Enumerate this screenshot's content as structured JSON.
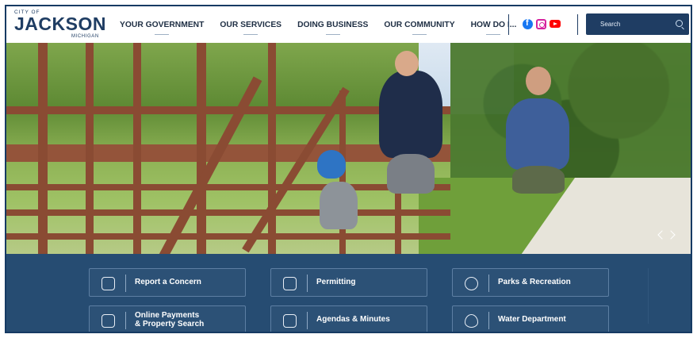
{
  "logo": {
    "top": "CITY OF",
    "main": "JACKSON",
    "sub": "MICHIGAN"
  },
  "nav": {
    "items": [
      {
        "label": "YOUR GOVERNMENT"
      },
      {
        "label": "OUR SERVICES"
      },
      {
        "label": "DOING BUSINESS"
      },
      {
        "label": "OUR COMMUNITY"
      },
      {
        "label": "HOW DO I..."
      }
    ]
  },
  "social": {
    "icons": [
      "facebook-icon",
      "instagram-icon",
      "youtube-icon"
    ]
  },
  "search": {
    "placeholder": "Search"
  },
  "hero": {
    "alt_colors": {
      "bridge": "#8a4b33",
      "foliage": "#4c7a30"
    }
  },
  "quick_links": [
    {
      "label": "Report a Concern",
      "icon": "chat-icon"
    },
    {
      "label": "Permitting",
      "icon": "clipboard-icon"
    },
    {
      "label": "Parks & Recreation",
      "icon": "basketball-icon"
    },
    {
      "label": "Online Payments\n& Property Search",
      "label_line1": "Online Payments",
      "label_line2": "& Property Search",
      "icon": "home-search-icon"
    },
    {
      "label": "Agendas & Minutes",
      "icon": "calendar-icon"
    },
    {
      "label": "Water Department",
      "icon": "water-drop-icon"
    }
  ],
  "colors": {
    "brand": "#1f3d63",
    "quick_bg": "#264c72"
  }
}
